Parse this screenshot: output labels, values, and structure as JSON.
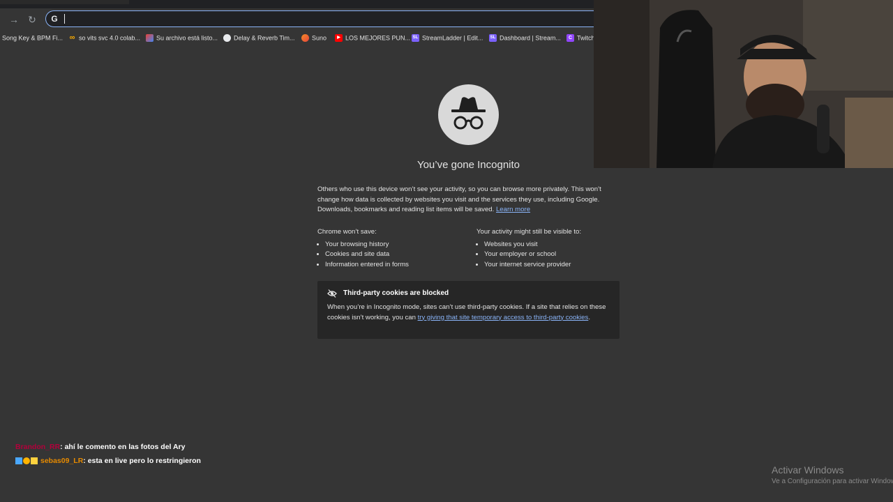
{
  "browser": {
    "omnibox": {
      "value": ""
    },
    "bookmarks": [
      {
        "label": "Song Key & BPM Fi...",
        "icon": ""
      },
      {
        "label": "so vits svc 4.0 colab...",
        "icon": "∞"
      },
      {
        "label": "Su archivo está listo...",
        "icon": ""
      },
      {
        "label": "Delay & Reverb Tim...",
        "icon": ""
      },
      {
        "label": "Suno",
        "icon": ""
      },
      {
        "label": "LOS MEJORES PUN...",
        "icon": "▶"
      },
      {
        "label": "StreamLadder | Edit...",
        "icon": "SL"
      },
      {
        "label": "Dashboard | Stream...",
        "icon": "SL"
      },
      {
        "label": "Twitch",
        "icon": "C"
      }
    ]
  },
  "incognito": {
    "title": "You’ve gone Incognito",
    "intro": "Others who use this device won’t see your activity, so you can browse more privately. This won’t change how data is collected by websites you visit and the services they use, including Google. Downloads, bookmarks and reading list items will be saved.",
    "learn_more": "Learn more",
    "wont_save": {
      "heading": "Chrome won’t save:",
      "items": [
        "Your browsing history",
        "Cookies and site data",
        "Information entered in forms"
      ]
    },
    "might_be_visible": {
      "heading": "Your activity might still be visible to:",
      "items": [
        "Websites you visit",
        "Your employer or school",
        "Your internet service provider"
      ]
    },
    "cookies": {
      "title": "Third-party cookies are blocked",
      "text": "When you’re in Incognito mode, sites can’t use third-party cookies. If a site that relies on these cookies isn’t working, you can ",
      "link": "try giving that site temporary access to third-party cookies",
      "end": "."
    }
  },
  "chat": [
    {
      "user": "Brandon_RR",
      "user_color": "#b3003b",
      "message": ": ahí le comento en las fotos del Ary"
    },
    {
      "user": "sebas09_LR",
      "user_color": "#e68a00",
      "message": ": esta en live pero lo restringieron"
    }
  ],
  "watermark": {
    "title": "Activar Windows",
    "subtitle": "Ve a Configuración para activar Windows."
  }
}
